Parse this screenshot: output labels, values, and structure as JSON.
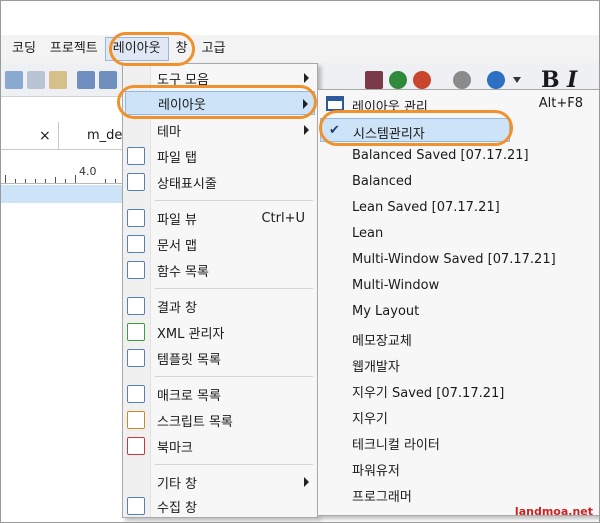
{
  "menubar": {
    "items": [
      "코딩",
      "프로젝트",
      "레이아웃",
      "창",
      "고급"
    ]
  },
  "tabs": {
    "close_glyph": "×",
    "second_tab": "m_de"
  },
  "ruler": {
    "number": "4.0"
  },
  "layout_menu": {
    "items": [
      {
        "label": "도구 모음",
        "shortcut": "",
        "submenu": true
      },
      {
        "label": "레이아웃",
        "shortcut": "",
        "submenu": true
      },
      {
        "label": "테마",
        "shortcut": "",
        "submenu": true
      },
      {
        "label": "파일 탭",
        "shortcut": "",
        "submenu": false
      },
      {
        "label": "상태표시줄",
        "shortcut": "",
        "submenu": false
      },
      {
        "label": "파일 뷰",
        "shortcut": "Ctrl+U",
        "submenu": false
      },
      {
        "label": "문서 맵",
        "shortcut": "",
        "submenu": false
      },
      {
        "label": "함수 목록",
        "shortcut": "",
        "submenu": false
      },
      {
        "label": "결과 창",
        "shortcut": "",
        "submenu": false
      },
      {
        "label": "XML 관리자",
        "shortcut": "",
        "submenu": false
      },
      {
        "label": "템플릿 목록",
        "shortcut": "",
        "submenu": false
      },
      {
        "label": "매크로 목록",
        "shortcut": "",
        "submenu": false
      },
      {
        "label": "스크립트 목록",
        "shortcut": "",
        "submenu": false
      },
      {
        "label": "북마크",
        "shortcut": "",
        "submenu": false
      },
      {
        "label": "기타 창",
        "shortcut": "",
        "submenu": true
      },
      {
        "label": "수집 창",
        "shortcut": "",
        "submenu": false
      }
    ]
  },
  "sub_menu": {
    "items": [
      {
        "label": "레이아웃 관리",
        "shortcut": "Alt+F8"
      },
      {
        "label": "시스템관리자",
        "shortcut": "",
        "checked": true
      },
      {
        "label": "Balanced Saved [07.17.21]",
        "shortcut": ""
      },
      {
        "label": "Balanced",
        "shortcut": ""
      },
      {
        "label": "Lean Saved [07.17.21]",
        "shortcut": ""
      },
      {
        "label": "Lean",
        "shortcut": ""
      },
      {
        "label": "Multi-Window Saved [07.17.21]",
        "shortcut": ""
      },
      {
        "label": "Multi-Window",
        "shortcut": ""
      },
      {
        "label": "My Layout",
        "shortcut": ""
      },
      {
        "label": "메모장교체",
        "shortcut": ""
      },
      {
        "label": "웹개발자",
        "shortcut": ""
      },
      {
        "label": "지우기 Saved [07.17.21]",
        "shortcut": ""
      },
      {
        "label": "지우기",
        "shortcut": ""
      },
      {
        "label": "테크니컬 라이터",
        "shortcut": ""
      },
      {
        "label": "파워유저",
        "shortcut": ""
      },
      {
        "label": "프로그래머",
        "shortcut": ""
      }
    ]
  },
  "toolbar": {
    "bold_glyph": "B",
    "italic_glyph": "I"
  },
  "colors": {
    "highlight": "#cde3f7",
    "oval": "#f0912b"
  },
  "watermark": "landmoa.net"
}
